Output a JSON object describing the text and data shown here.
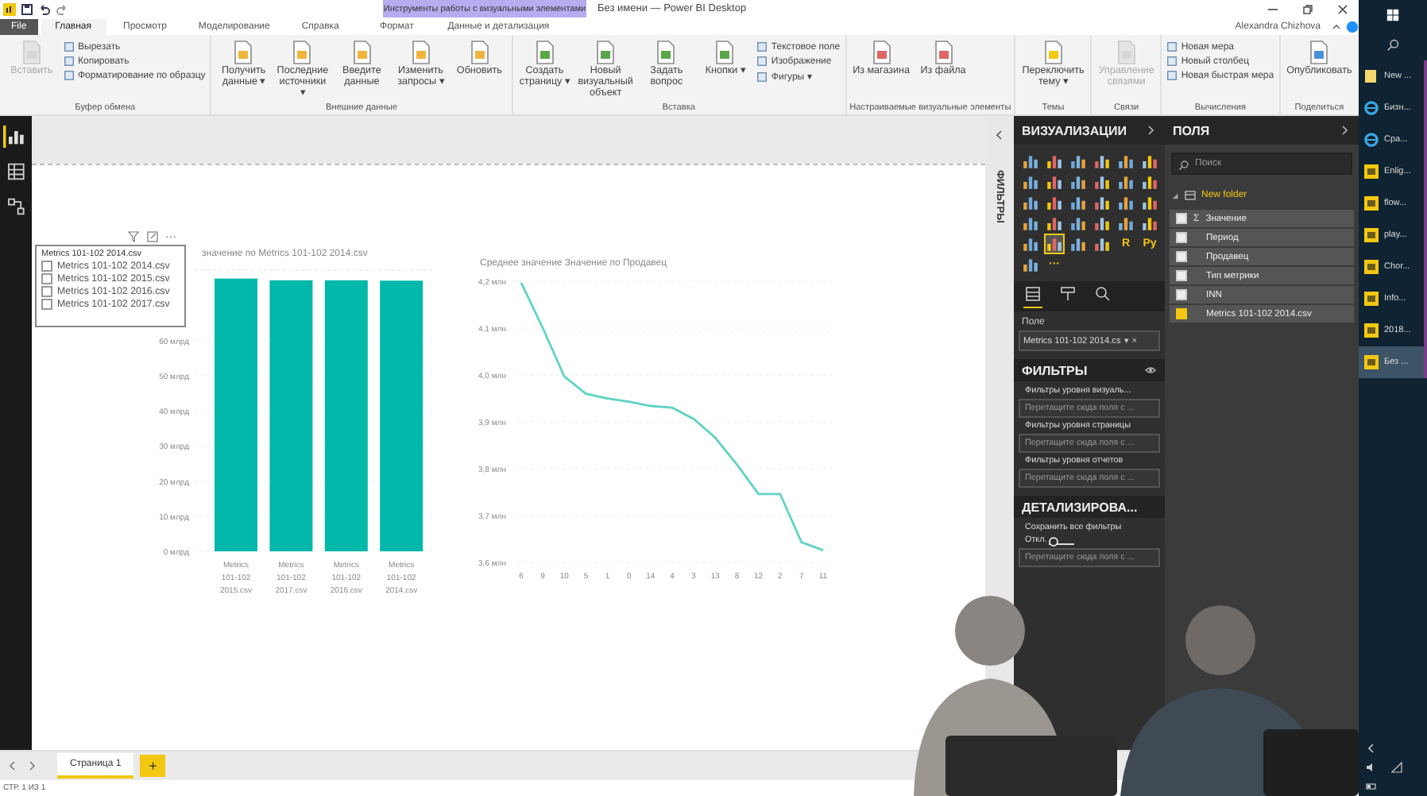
{
  "window": {
    "title": "Без имени — Power BI Desktop",
    "user": "Alexandra Chizhova"
  },
  "tabs": [
    {
      "label": "File",
      "kind": "file",
      "selected": false
    },
    {
      "label": "Главная",
      "kind": "tab",
      "selected": true
    },
    {
      "label": "Просмотр",
      "kind": "tab",
      "selected": false
    },
    {
      "label": "Моделирование",
      "kind": "tab",
      "selected": false
    },
    {
      "label": "Справка",
      "kind": "tab",
      "selected": false
    }
  ],
  "context_group": {
    "label": "Инструменты работы с визуальными элементами",
    "tabs": [
      {
        "label": "Формат",
        "selected": false
      },
      {
        "label": "Данные и детализация",
        "selected": false
      }
    ]
  },
  "ribbon": [
    {
      "label": "Буфер обмена",
      "buttons": [
        {
          "label": "Вставить",
          "kind": "large",
          "disabled": true
        },
        {
          "label": "Вырезать",
          "kind": "small",
          "disabled": false
        },
        {
          "label": "Копировать",
          "kind": "small",
          "disabled": false
        },
        {
          "label": "Форматирование по образцу",
          "kind": "small",
          "disabled": false
        }
      ]
    },
    {
      "label": "Внешние данные",
      "buttons": [
        {
          "label": "Получить данные ▾",
          "kind": "large",
          "disabled": false
        },
        {
          "label": "Последние источники ▾",
          "kind": "large",
          "disabled": false
        },
        {
          "label": "Введите данные",
          "kind": "large",
          "disabled": false
        },
        {
          "label": "Изменить запросы ▾",
          "kind": "large",
          "disabled": false
        },
        {
          "label": "Обновить",
          "kind": "large",
          "disabled": false
        }
      ]
    },
    {
      "label": "Вставка",
      "buttons": [
        {
          "label": "Создать страницу ▾",
          "kind": "large",
          "disabled": false
        },
        {
          "label": "Новый визуальный объект",
          "kind": "large",
          "disabled": false
        },
        {
          "label": "Задать вопрос",
          "kind": "large",
          "disabled": false
        },
        {
          "label": "Кнопки ▾",
          "kind": "large",
          "disabled": false
        },
        {
          "label": "Текстовое поле",
          "kind": "small",
          "disabled": false
        },
        {
          "label": "Изображение",
          "kind": "small",
          "disabled": false
        },
        {
          "label": "Фигуры ▾",
          "kind": "small",
          "disabled": false
        }
      ]
    },
    {
      "label": "Настраиваемые визуальные элементы",
      "buttons": [
        {
          "label": "Из магазина",
          "kind": "large",
          "disabled": false
        },
        {
          "label": "Из файла",
          "kind": "large",
          "disabled": false
        }
      ]
    },
    {
      "label": "Темы",
      "buttons": [
        {
          "label": "Переключить тему ▾",
          "kind": "large",
          "disabled": false
        }
      ]
    },
    {
      "label": "Связи",
      "buttons": [
        {
          "label": "Управление связями",
          "kind": "large",
          "disabled": true
        }
      ]
    },
    {
      "label": "Вычисления",
      "buttons": [
        {
          "label": "Новая мера",
          "kind": "small",
          "disabled": false
        },
        {
          "label": "Новый столбец",
          "kind": "small",
          "disabled": false
        },
        {
          "label": "Новая быстрая мера",
          "kind": "small",
          "disabled": false
        }
      ]
    },
    {
      "label": "Поделиться",
      "buttons": [
        {
          "label": "Опубликовать",
          "kind": "large",
          "disabled": false
        }
      ]
    }
  ],
  "nav": [
    {
      "kind": "report",
      "selected": true
    },
    {
      "kind": "data",
      "selected": false
    },
    {
      "kind": "model",
      "selected": false
    }
  ],
  "canvas": {
    "slicer": {
      "title": "Metrics 101-102 2014.csv",
      "items": [
        {
          "label": "Metrics 101-102 2014.csv",
          "checked": false
        },
        {
          "label": "Metrics 101-102 2015.csv",
          "checked": false
        },
        {
          "label": "Metrics 101-102 2016.csv",
          "checked": false
        },
        {
          "label": "Metrics 101-102 2017.csv",
          "checked": false
        }
      ],
      "more": "···"
    },
    "bar_chart": {
      "chart_data": {
        "type": "bar",
        "title": "значение по Metrics 101-102 2014.csv",
        "categories": [
          "Metrics 101-102 2015.csv",
          "Metrics 101-102 2017.csv",
          "Metrics 101-102 2016.csv",
          "Metrics 101-102 2014.csv"
        ],
        "values": [
          77.6,
          77.1,
          77.1,
          77.0
        ],
        "ylim": [
          0,
          80
        ],
        "grid": true,
        "yticks": [
          {
            "value": 0,
            "label": "0 млрд"
          },
          {
            "value": 10,
            "label": "10 млрд"
          },
          {
            "value": 20,
            "label": "20 млрд"
          },
          {
            "value": 30,
            "label": "30 млрд"
          },
          {
            "value": 40,
            "label": "40 млрд"
          },
          {
            "value": 50,
            "label": "50 млрд"
          },
          {
            "value": 60,
            "label": "60 млрд"
          }
        ]
      }
    },
    "line_chart": {
      "chart_data": {
        "type": "line",
        "title": "Среднее значение Значение по Продавец",
        "categories": [
          "6",
          "9",
          "10",
          "5",
          "1",
          "0",
          "14",
          "4",
          "3",
          "13",
          "8",
          "12",
          "2",
          "7",
          "11"
        ],
        "values": [
          4.197,
          4.1,
          3.997,
          3.96,
          3.95,
          3.943,
          3.934,
          3.93,
          3.906,
          3.866,
          3.809,
          3.746,
          3.746,
          3.643,
          3.626
        ],
        "ylim": [
          3.6,
          4.2
        ],
        "grid": true,
        "yticks": [
          {
            "value": 3.6,
            "label": "3,6 млн"
          },
          {
            "value": 3.7,
            "label": "3,7 млн"
          },
          {
            "value": 3.8,
            "label": "3,8 млн"
          },
          {
            "value": 3.9,
            "label": "3,9 млн"
          },
          {
            "value": 4.0,
            "label": "4,0 млн"
          },
          {
            "value": 4.1,
            "label": "4,1 млн"
          },
          {
            "value": 4.2,
            "label": "4,2 млн"
          }
        ]
      }
    }
  },
  "filters_strip": {
    "label": "ФИЛЬТРЫ"
  },
  "visualizations": {
    "title": "ВИЗУАЛИЗАЦИИ",
    "types": [
      {
        "kind": "icon",
        "selected": false
      },
      {
        "kind": "icon",
        "selected": false
      },
      {
        "kind": "icon",
        "selected": false
      },
      {
        "kind": "icon",
        "selected": false
      },
      {
        "kind": "icon",
        "selected": false
      },
      {
        "kind": "icon",
        "selected": false
      },
      {
        "kind": "icon",
        "selected": false
      },
      {
        "kind": "icon",
        "selected": false
      },
      {
        "kind": "icon",
        "selected": false
      },
      {
        "kind": "icon",
        "selected": false
      },
      {
        "kind": "icon",
        "selected": false
      },
      {
        "kind": "icon",
        "selected": false
      },
      {
        "kind": "icon",
        "selected": false
      },
      {
        "kind": "icon",
        "selected": false
      },
      {
        "kind": "icon",
        "selected": false
      },
      {
        "kind": "icon",
        "selected": false
      },
      {
        "kind": "icon",
        "selected": false
      },
      {
        "kind": "icon",
        "selected": false
      },
      {
        "kind": "icon",
        "selected": false
      },
      {
        "kind": "icon",
        "selected": false
      },
      {
        "kind": "icon",
        "selected": false
      },
      {
        "kind": "icon",
        "selected": false
      },
      {
        "kind": "icon",
        "selected": false
      },
      {
        "kind": "icon",
        "selected": false
      },
      {
        "kind": "icon",
        "selected": false
      },
      {
        "kind": "icon",
        "selected": true
      },
      {
        "kind": "icon",
        "selected": false
      },
      {
        "kind": "icon",
        "selected": false
      },
      {
        "kind": "text",
        "label": "R",
        "selected": false
      },
      {
        "kind": "text",
        "label": "Py",
        "selected": false
      },
      {
        "kind": "icon",
        "selected": false
      },
      {
        "kind": "text",
        "label": "···",
        "selected": false
      }
    ],
    "pane_tabs": [
      {
        "kind": "fields",
        "selected": true
      },
      {
        "kind": "format",
        "selected": false
      },
      {
        "kind": "analytics",
        "selected": false
      }
    ],
    "well_label": "Поле",
    "well_value": "Metrics 101-102 2014.cs",
    "well_caret": "▾",
    "well_remove": "×"
  },
  "filters": {
    "title": "ФИЛЬТРЫ",
    "sections": [
      {
        "title": "Фильтры уровня визуаль...",
        "placeholder": "Перетащите сюда поля с ..."
      },
      {
        "title": "Фильтры уровня страницы",
        "placeholder": "Перетащите сюда поля с ..."
      },
      {
        "title": "Фильтры уровня отчетов",
        "placeholder": "Перетащите сюда поля с ..."
      }
    ]
  },
  "drillthrough": {
    "title": "ДЕТАЛИЗИРОВА...",
    "keep_filters": "Сохранить все фильтры",
    "toggle": {
      "label": "Откл.",
      "on": false
    },
    "placeholder": "Перетащите сюда поля с ..."
  },
  "fields": {
    "title": "ПОЛЯ",
    "search": {
      "placeholder": "Поиск"
    },
    "tree": [
      {
        "label": "New folder",
        "expanded": true,
        "children": [
          {
            "label": "Значение",
            "symbol": "Σ",
            "checked": false
          },
          {
            "label": "Период",
            "checked": false
          },
          {
            "label": "Продавец",
            "checked": false
          },
          {
            "label": "Тип метрики",
            "checked": false
          },
          {
            "label": "INN",
            "checked": false
          },
          {
            "label": "Metrics 101-102 2014.csv",
            "checked": true
          }
        ]
      }
    ]
  },
  "pages": [
    {
      "label": "Страница 1",
      "selected": true
    }
  ],
  "add_page": "+",
  "status_bar": "СТР. 1 ИЗ 1",
  "taskbar": [
    {
      "label": "New ...",
      "kind": "folder",
      "selected": false
    },
    {
      "label": "Бизн...",
      "kind": "browser",
      "selected": false
    },
    {
      "label": "Сра...",
      "kind": "browser",
      "selected": false
    },
    {
      "label": "Enlig...",
      "kind": "app",
      "selected": false
    },
    {
      "label": "flow...",
      "kind": "app",
      "selected": false
    },
    {
      "label": "play...",
      "kind": "app",
      "selected": false
    },
    {
      "label": "Chor...",
      "kind": "app",
      "selected": false
    },
    {
      "label": "Info...",
      "kind": "app",
      "selected": false
    },
    {
      "label": "2018...",
      "kind": "app",
      "selected": false
    },
    {
      "label": "Без ...",
      "kind": "app",
      "selected": true
    }
  ]
}
